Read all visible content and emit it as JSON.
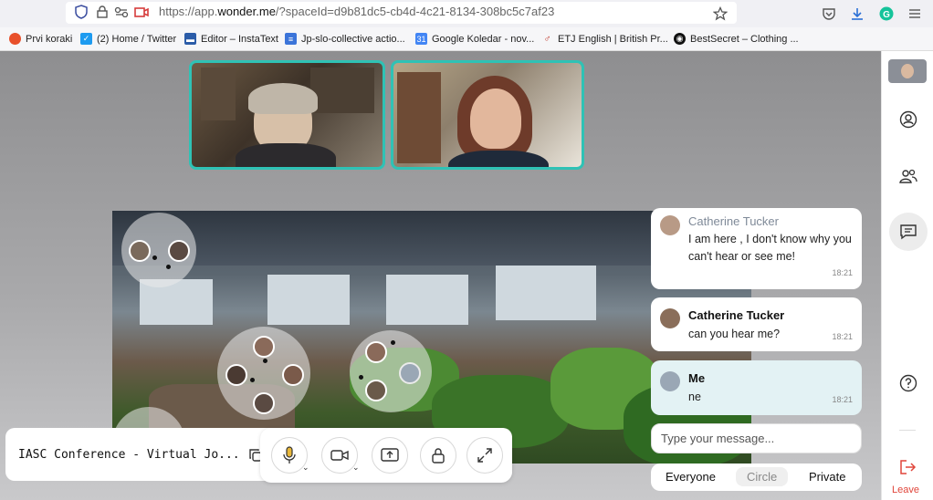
{
  "browser": {
    "url_prefix": "https://app.",
    "url_domain": "wonder.me",
    "url_suffix": "/?spaceId=d9b81dc5-cb4d-4c21-8134-308bc5c7af23"
  },
  "bookmarks": [
    {
      "label": "Prvi koraki",
      "color": "#e8502a",
      "icon": "firefox-icon"
    },
    {
      "label": "(2) Home / Twitter",
      "color": "#1d9bf0",
      "icon": "twitter-icon"
    },
    {
      "label": "Editor – InstaText",
      "color": "#2b5ca8",
      "icon": "instatext-icon"
    },
    {
      "label": "Jp-slo-collective actio...",
      "color": "#3b74d9",
      "icon": "docs-icon"
    },
    {
      "label": "Google Koledar - nov...",
      "color": "#4285f4",
      "icon": "calendar-icon"
    },
    {
      "label": "ETJ English | British Pr...",
      "color": "#c0392b",
      "icon": "etj-icon"
    },
    {
      "label": "BestSecret – Clothing ...",
      "color": "#111111",
      "icon": "bestsecret-icon"
    }
  ],
  "conference": {
    "title": "IASC Conference - Virtual Jo..."
  },
  "chat": {
    "messages": [
      {
        "name": "Catherine Tucker",
        "text": "I am here , I don't know why you can't hear or see me!",
        "time": "18:21"
      },
      {
        "name": "Catherine Tucker",
        "text": "can you hear me?",
        "time": "18:21"
      },
      {
        "name": "Me",
        "text": "ne",
        "time": "18:21"
      }
    ],
    "input_placeholder": "Type your message...",
    "audiences": [
      "Everyone",
      "Circle",
      "Private"
    ],
    "active_audience": "Circle"
  },
  "rail": {
    "leave_label": "Leave"
  },
  "colors": {
    "accent": "#2fc2b5",
    "leave": "#e0453a",
    "me_bubble": "#e3f2f4"
  }
}
